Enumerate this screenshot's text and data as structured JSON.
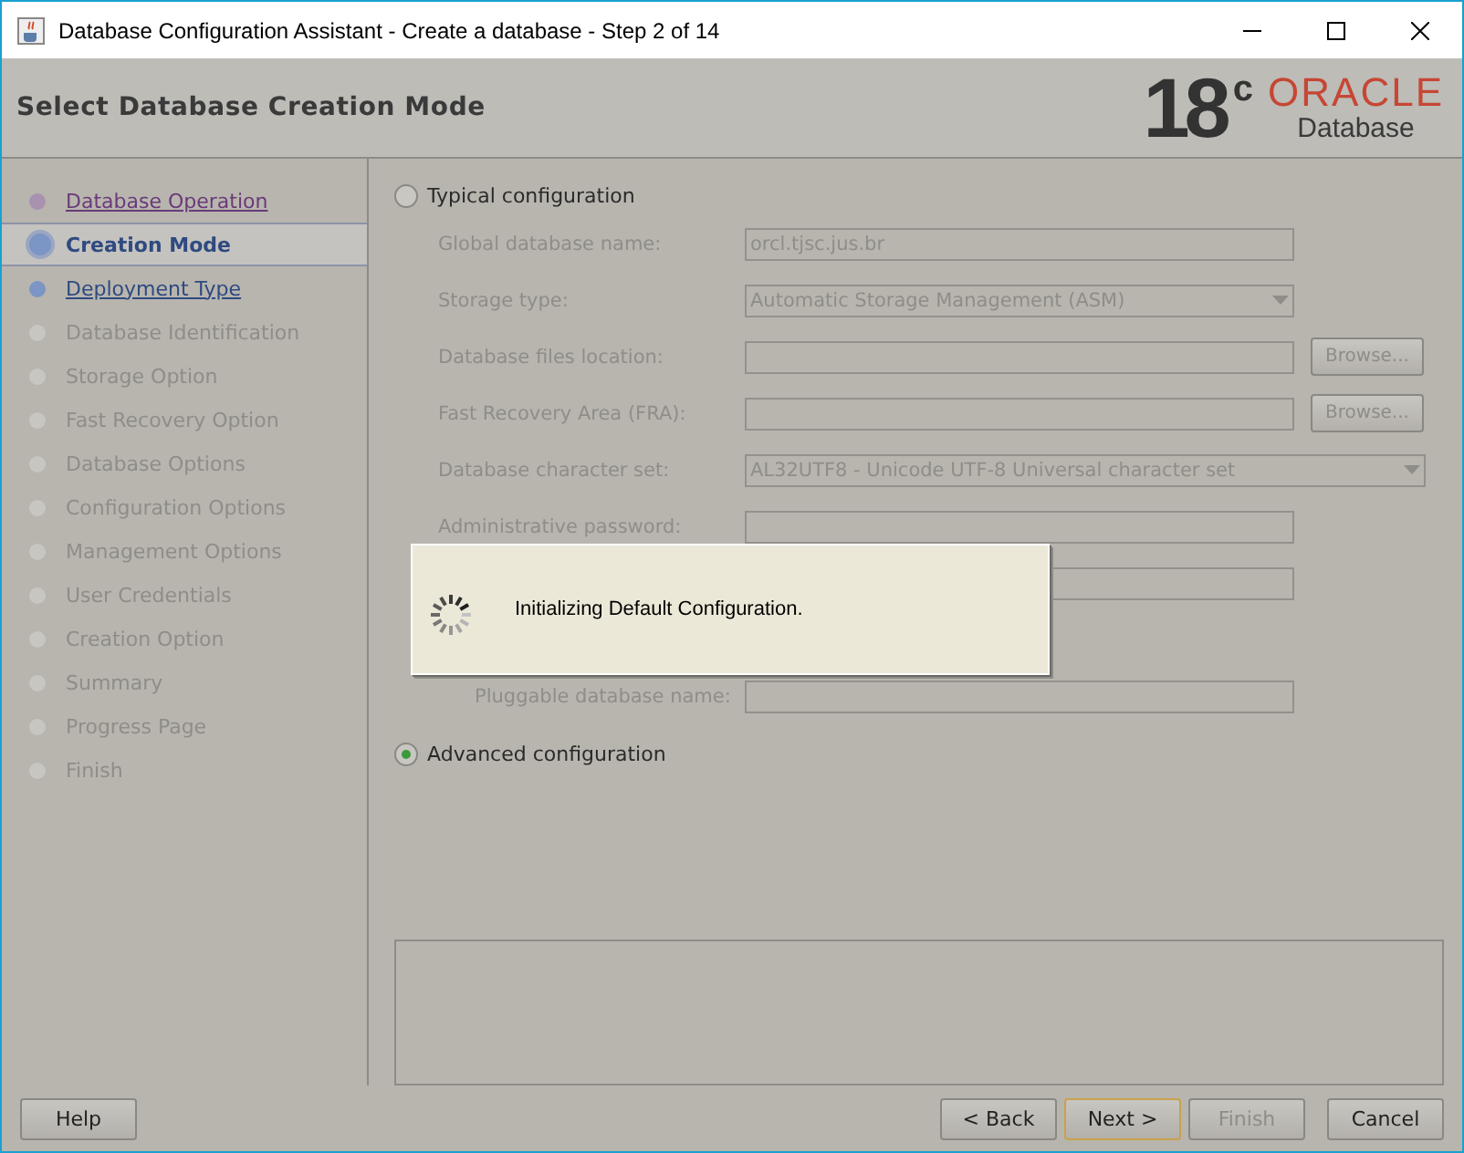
{
  "window": {
    "title": "Database Configuration Assistant - Create a database - Step 2 of 14"
  },
  "header": {
    "title": "Select Database Creation Mode",
    "logo": {
      "version": "18",
      "suffix": "c",
      "brand": "ORACLE",
      "product": "Database"
    }
  },
  "steps": [
    {
      "label": "Database Operation",
      "kind": "visited",
      "selected": false
    },
    {
      "label": "Creation Mode",
      "kind": "current",
      "selected": true
    },
    {
      "label": "Deployment Type",
      "kind": "link",
      "selected": false
    },
    {
      "label": "Database Identification",
      "kind": "disabled",
      "selected": false
    },
    {
      "label": "Storage Option",
      "kind": "disabled",
      "selected": false
    },
    {
      "label": "Fast Recovery Option",
      "kind": "disabled",
      "selected": false
    },
    {
      "label": "Database Options",
      "kind": "disabled",
      "selected": false
    },
    {
      "label": "Configuration Options",
      "kind": "disabled",
      "selected": false
    },
    {
      "label": "Management Options",
      "kind": "disabled",
      "selected": false
    },
    {
      "label": "User Credentials",
      "kind": "disabled",
      "selected": false
    },
    {
      "label": "Creation Option",
      "kind": "disabled",
      "selected": false
    },
    {
      "label": "Summary",
      "kind": "disabled",
      "selected": false
    },
    {
      "label": "Progress Page",
      "kind": "disabled",
      "selected": false
    },
    {
      "label": "Finish",
      "kind": "disabled",
      "selected": false
    }
  ],
  "typical": {
    "label": "Typical configuration",
    "selected": false,
    "disabled": true,
    "fields": [
      {
        "kind": "text",
        "label": "Global database name:",
        "value": "orcl.tjsc.jus.br"
      },
      {
        "kind": "select",
        "label": "Storage type:",
        "value": "Automatic Storage Management (ASM)"
      },
      {
        "kind": "browse",
        "label": "Database files location:",
        "button": "Browse..."
      },
      {
        "kind": "browse",
        "label": "Fast Recovery Area (FRA):",
        "button": "Browse..."
      },
      {
        "kind": "wideselect",
        "label": "Database character set:",
        "value": "AL32UTF8 - Unicode UTF-8 Universal character set"
      },
      {
        "kind": "text",
        "label": "Administrative password:"
      },
      {
        "kind": "text"
      },
      {
        "kind": "blank"
      },
      {
        "kind": "indented",
        "label": "Pluggable database name:"
      }
    ]
  },
  "advanced": {
    "label": "Advanced configuration",
    "selected": true
  },
  "dialog": {
    "message": "Initializing Default Configuration."
  },
  "buttons": {
    "left": [
      {
        "label": "Help",
        "disabled": false,
        "default": false
      }
    ],
    "right": [
      {
        "label": "< Back",
        "disabled": false,
        "default": false
      },
      {
        "label": "Next >",
        "disabled": false,
        "default": true
      },
      {
        "label": "Finish",
        "disabled": true,
        "default": false
      },
      {
        "label": "Cancel",
        "disabled": false,
        "default": false
      }
    ]
  }
}
